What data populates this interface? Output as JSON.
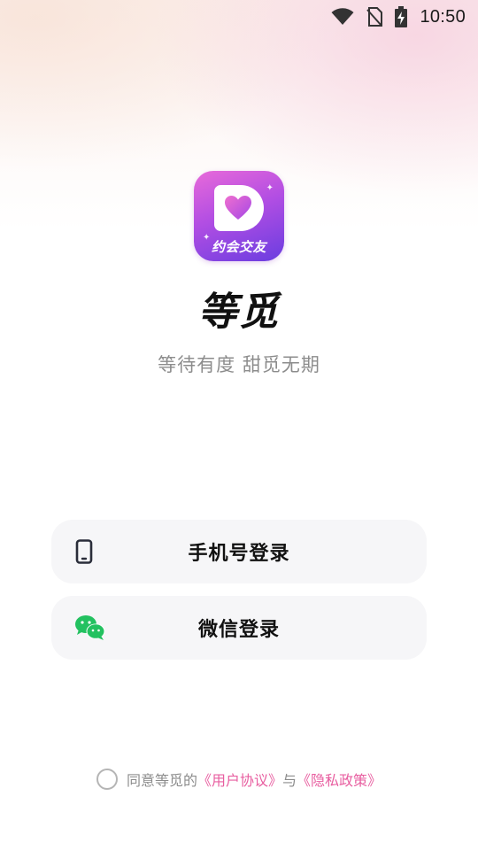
{
  "status_bar": {
    "time": "10:50",
    "icons": [
      "wifi-icon",
      "no-sim-icon",
      "battery-charging-icon"
    ]
  },
  "app": {
    "icon_text": "约会交友",
    "name": "等觅",
    "slogan": "等待有度 甜觅无期"
  },
  "login": {
    "phone_label": "手机号登录",
    "phone_icon": "phone-icon",
    "wechat_label": "微信登录",
    "wechat_icon": "wechat-icon"
  },
  "agreement": {
    "prefix": "同意等觅的",
    "user_agreement": "《用户协议》",
    "conjunction": "与",
    "privacy_policy": "《隐私政策》",
    "checked": false
  },
  "colors": {
    "link": "#e85ea0",
    "wechat_green": "#23c160",
    "button_bg": "#f6f6f8"
  }
}
